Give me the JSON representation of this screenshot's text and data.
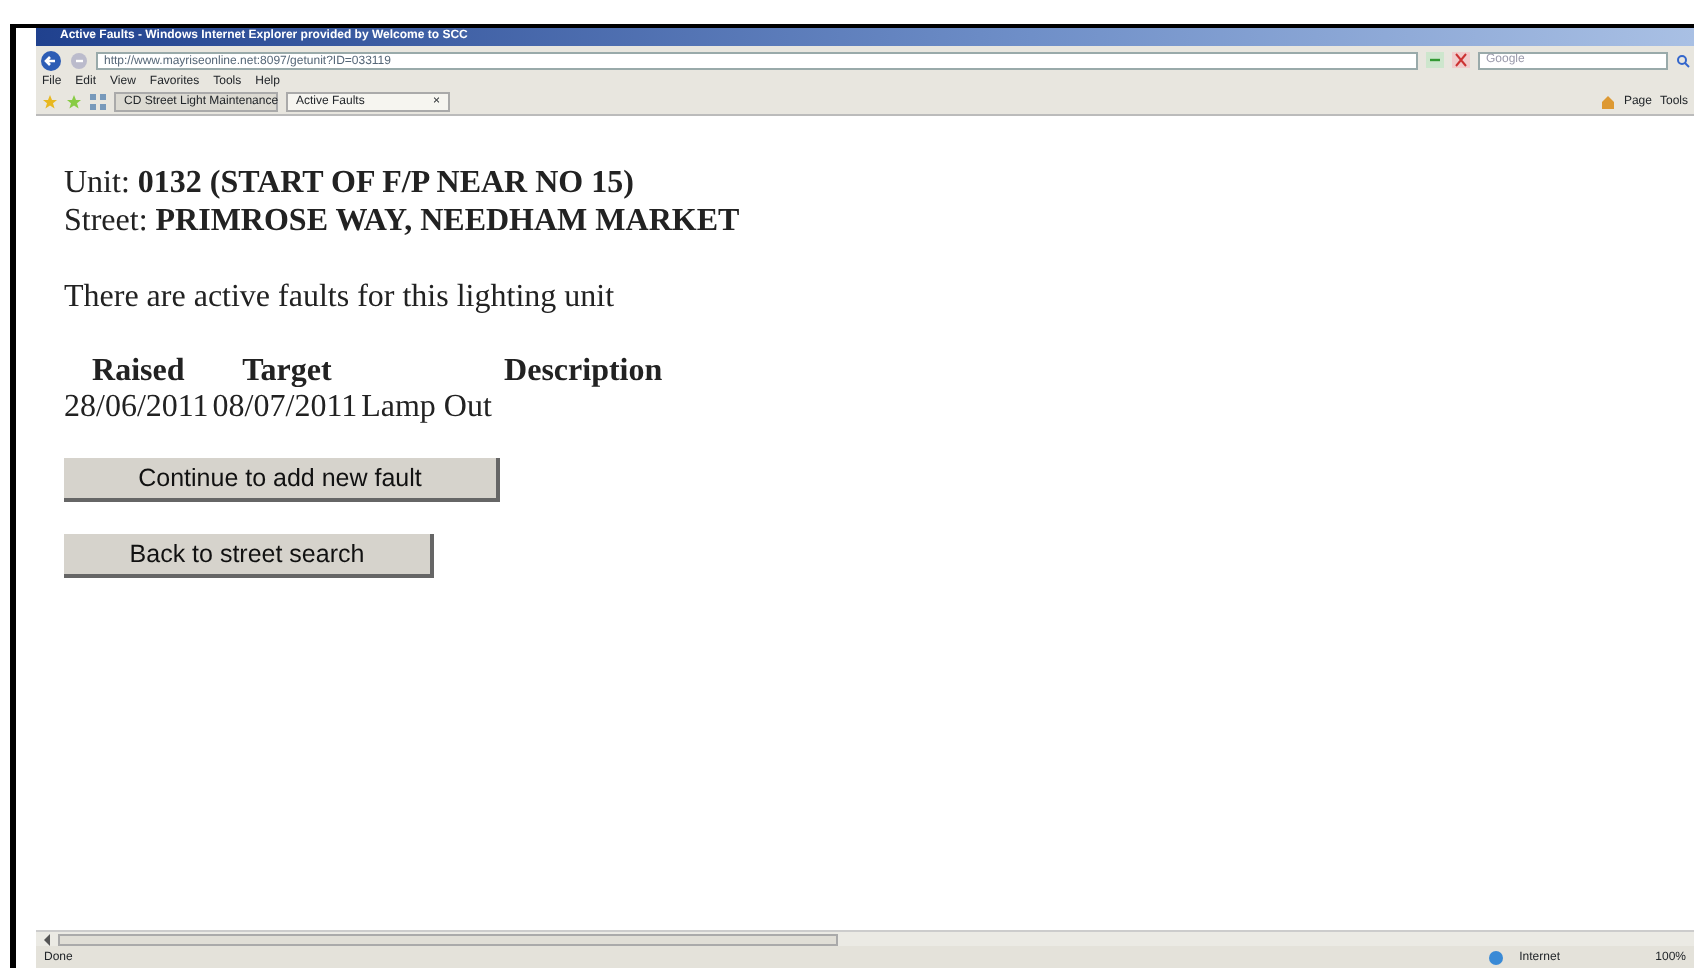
{
  "window": {
    "title": "Active Faults - Windows Internet Explorer provided by Welcome to SCC"
  },
  "address_bar": {
    "value": "http://www.mayriseonline.net:8097/getunit?ID=033119"
  },
  "search": {
    "placeholder": "Google"
  },
  "menu": [
    "File",
    "Edit",
    "View",
    "Favorites",
    "Tools",
    "Help"
  ],
  "tabs": [
    {
      "label": "CD Street Light Maintenance",
      "selected": false
    },
    {
      "label": "Active Faults",
      "selected": true,
      "close": "×"
    }
  ],
  "command_bar": [
    "Page",
    "Tools"
  ],
  "unit": {
    "label": "Unit:",
    "value": "0132 (START OF F/P NEAR NO 15)"
  },
  "street": {
    "label": "Street:",
    "value": "PRIMROSE WAY, NEEDHAM MARKET"
  },
  "message": "There are active faults for this lighting unit",
  "table": {
    "columns": [
      "Raised",
      "Target",
      "Description"
    ],
    "rows": [
      [
        "28/06/2011",
        "08/07/2011",
        "Lamp Out"
      ]
    ]
  },
  "buttons": [
    "Continue to add new fault",
    "Back to street search"
  ],
  "status_bar": {
    "status": "Done",
    "zone": "Internet",
    "zoom": "100%"
  }
}
